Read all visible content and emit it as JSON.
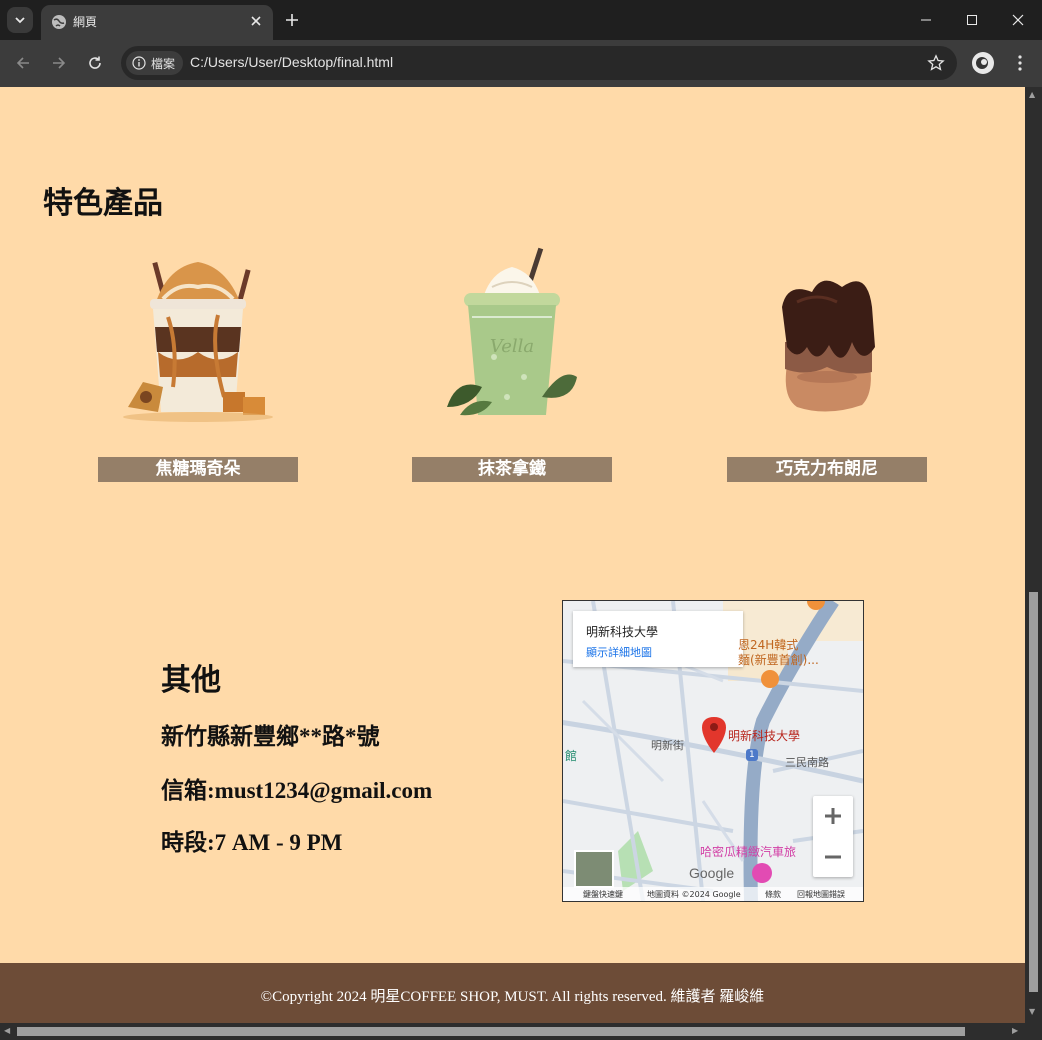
{
  "browser": {
    "tab_title": "網頁",
    "site_chip": "檔案",
    "url": "C:/Users/User/Desktop/final.html"
  },
  "page": {
    "section_title": "特色產品",
    "products": [
      {
        "label": "焦糖瑪奇朵",
        "icon": "caramel-macchiato-image"
      },
      {
        "label": "抹茶拿鐵",
        "icon": "matcha-latte-image"
      },
      {
        "label": "巧克力布朗尼",
        "icon": "chocolate-brownie-image"
      }
    ],
    "other": {
      "title": "其他",
      "address": "新竹縣新豐鄉**路*號",
      "email": "信箱:must1234@gmail.com",
      "hours": "時段:7 AM - 9 PM"
    },
    "map": {
      "place_name": "明新科技大學",
      "view_larger": "顯示詳細地圖",
      "marker_label": "明新科技大學",
      "street_1": "明新街",
      "street_2": "三民南路",
      "poi_1": "恩24H韓式",
      "poi_2": "麵(新豐首創)...",
      "poi_3": "哈密瓜精緻汽車旅",
      "poi_left": "館",
      "road_number": "1",
      "google": "Google",
      "footer_items": [
        "鍵盤快速鍵",
        "地圖資料 ©2024 Google",
        "條款",
        "回報地圖錯誤"
      ]
    },
    "footer": "©Copyright 2024 明星COFFEE SHOP, MUST. All rights reserved. 維護者 羅峻維"
  },
  "colors": {
    "page_bg": "#ffdaa9",
    "label_bg": "#957f68",
    "footer_bg": "#6d4c37"
  }
}
